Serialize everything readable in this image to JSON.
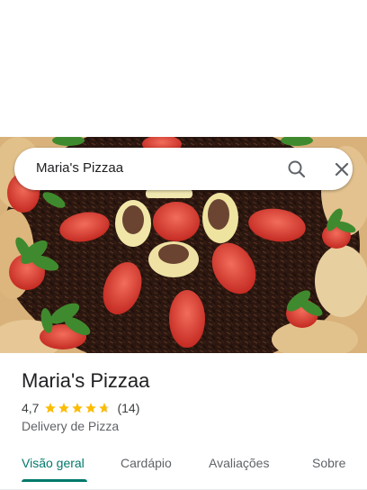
{
  "search": {
    "query": "Maria's Pizzaa"
  },
  "place": {
    "name": "Maria's Pizzaa",
    "rating": "4,7",
    "stars": 4.7,
    "review_count": "(14)",
    "category": "Delivery de Pizza"
  },
  "tabs": [
    {
      "label": "Visão geral",
      "active": true
    },
    {
      "label": "Cardápio",
      "active": false
    },
    {
      "label": "Avaliações",
      "active": false
    },
    {
      "label": "Sobre",
      "active": false
    }
  ],
  "colors": {
    "accent": "#00796b",
    "star": "#fbbc04",
    "text_primary": "#202124",
    "text_secondary": "#5f6368"
  },
  "icons": {
    "search": "search-icon",
    "close": "close-icon"
  }
}
